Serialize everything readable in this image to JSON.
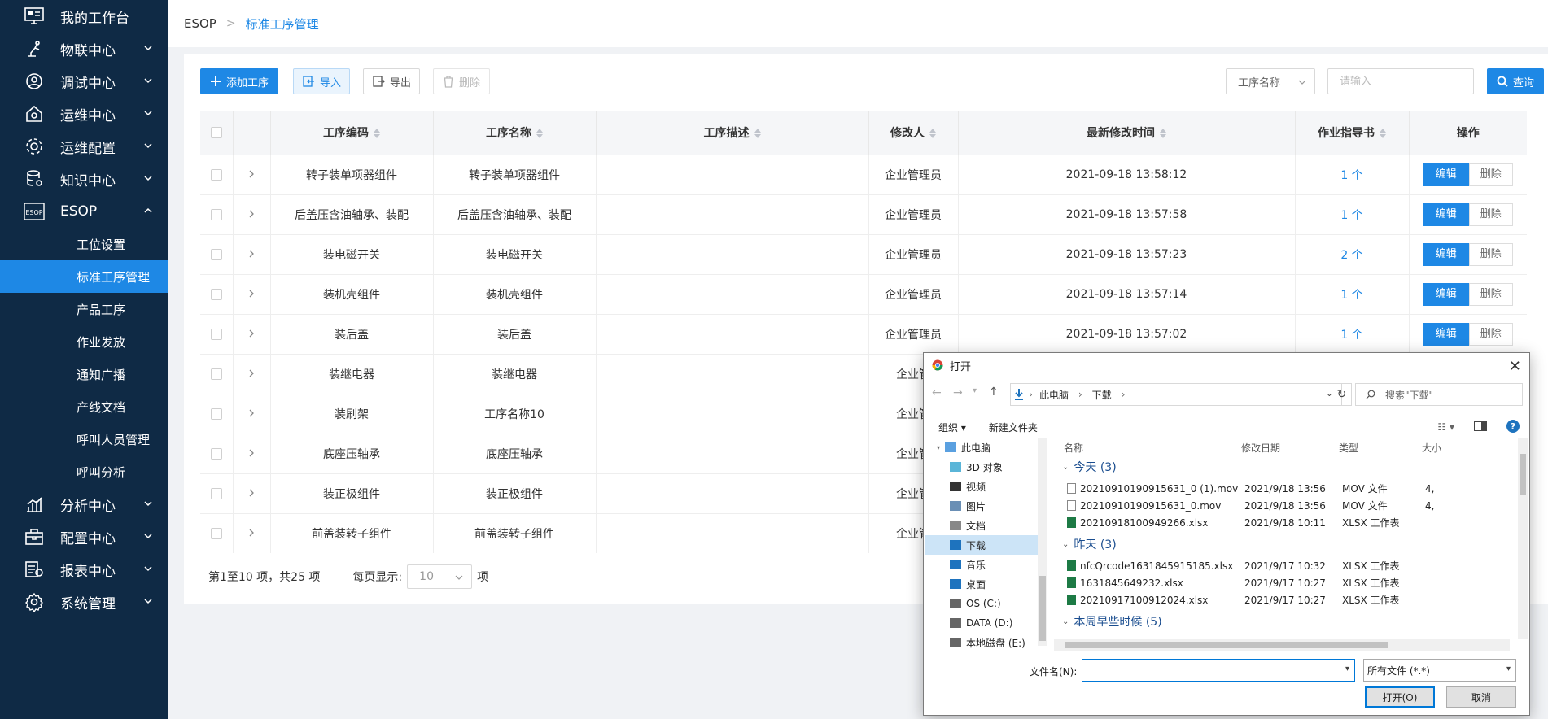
{
  "sidebar": {
    "menu": [
      {
        "label": "我的工作台",
        "icon": "workbench-icon",
        "chevron": false
      },
      {
        "label": "物联中心",
        "icon": "robot-arm-icon",
        "chevron": true
      },
      {
        "label": "调试中心",
        "icon": "debug-icon",
        "chevron": true
      },
      {
        "label": "运维中心",
        "icon": "house-gear-icon",
        "chevron": true
      },
      {
        "label": "运维配置",
        "icon": "gear-icon",
        "chevron": true
      },
      {
        "label": "知识中心",
        "icon": "database-icon",
        "chevron": true
      },
      {
        "label": "ESOP",
        "icon": "esop-icon",
        "chevron": true,
        "expanded": true
      }
    ],
    "esop_badge": "ESOP",
    "submenu": [
      "工位设置",
      "标准工序管理",
      "产品工序",
      "作业发放",
      "通知广播",
      "产线文档",
      "呼叫人员管理",
      "呼叫分析"
    ],
    "active_submenu": "标准工序管理",
    "menu_after": [
      {
        "label": "分析中心",
        "icon": "bar-chart-icon"
      },
      {
        "label": "配置中心",
        "icon": "toolbox-icon"
      },
      {
        "label": "报表中心",
        "icon": "report-icon"
      },
      {
        "label": "系统管理",
        "icon": "settings-icon"
      }
    ]
  },
  "breadcrumb": {
    "root": "ESOP",
    "current": "标准工序管理"
  },
  "toolbar": {
    "add": "添加工序",
    "import": "导入",
    "export": "导出",
    "delete": "删除",
    "filter_field": "工序名称",
    "search_placeholder": "请输入",
    "query": "查询"
  },
  "table": {
    "headers": [
      "工序编码",
      "工序名称",
      "工序描述",
      "修改人",
      "最新修改时间",
      "作业指导书",
      "操作"
    ],
    "rows": [
      {
        "code": "转子装单项器组件",
        "name": "转子装单项器组件",
        "desc": "",
        "modifier": "企业管理员",
        "time": "2021-09-18 13:58:12",
        "docs": "1 个"
      },
      {
        "code": "后盖压含油轴承、装配",
        "name": "后盖压含油轴承、装配",
        "desc": "",
        "modifier": "企业管理员",
        "time": "2021-09-18 13:57:58",
        "docs": "1 个"
      },
      {
        "code": "装电磁开关",
        "name": "装电磁开关",
        "desc": "",
        "modifier": "企业管理员",
        "time": "2021-09-18 13:57:23",
        "docs": "2 个"
      },
      {
        "code": "装机壳组件",
        "name": "装机壳组件",
        "desc": "",
        "modifier": "企业管理员",
        "time": "2021-09-18 13:57:14",
        "docs": "1 个"
      },
      {
        "code": "装后盖",
        "name": "装后盖",
        "desc": "",
        "modifier": "企业管理员",
        "time": "2021-09-18 13:57:02",
        "docs": "1 个"
      },
      {
        "code": "装继电器",
        "name": "装继电器",
        "desc": "",
        "modifier": "企业管",
        "time": "",
        "docs": ""
      },
      {
        "code": "装刷架",
        "name": "工序名称10",
        "desc": "",
        "modifier": "企业管",
        "time": "",
        "docs": ""
      },
      {
        "code": "底座压轴承",
        "name": "底座压轴承",
        "desc": "",
        "modifier": "企业管",
        "time": "",
        "docs": ""
      },
      {
        "code": "装正极组件",
        "name": "装正极组件",
        "desc": "",
        "modifier": "企业管",
        "time": "",
        "docs": ""
      },
      {
        "code": "前盖装转子组件",
        "name": "前盖装转子组件",
        "desc": "",
        "modifier": "企业管",
        "time": "",
        "docs": ""
      }
    ],
    "edit": "编辑",
    "del": "删除"
  },
  "pager": {
    "summary": "第1至10 项，共25 项",
    "per_page_label": "每页显示:",
    "per_page": "10",
    "unit": "项"
  },
  "dialog": {
    "title": "打开",
    "path": [
      "此电脑",
      "下载"
    ],
    "search_placeholder": "搜索\"下载\"",
    "organize": "组织 ▾",
    "new_folder": "新建文件夹",
    "tree": [
      "此电脑",
      "3D 对象",
      "视频",
      "图片",
      "文档",
      "下载",
      "音乐",
      "桌面",
      "OS (C:)",
      "DATA (D:)",
      "本地磁盘 (E:)"
    ],
    "columns": [
      "名称",
      "修改日期",
      "类型",
      "大小"
    ],
    "groups": [
      {
        "label": "今天 (3)",
        "files": [
          {
            "name": "20210910190915631_0 (1).mov",
            "date": "2021/9/18 13:56",
            "type": "MOV 文件",
            "size": "4,"
          },
          {
            "name": "20210910190915631_0.mov",
            "date": "2021/9/18 13:56",
            "type": "MOV 文件",
            "size": "4,"
          },
          {
            "name": "20210918100949266.xlsx",
            "date": "2021/9/18 10:11",
            "type": "XLSX 工作表",
            "size": ""
          }
        ]
      },
      {
        "label": "昨天 (3)",
        "files": [
          {
            "name": "nfcQrcode1631845915185.xlsx",
            "date": "2021/9/17 10:32",
            "type": "XLSX 工作表",
            "size": ""
          },
          {
            "name": "1631845649232.xlsx",
            "date": "2021/9/17 10:27",
            "type": "XLSX 工作表",
            "size": ""
          },
          {
            "name": "20210917100912024.xlsx",
            "date": "2021/9/17 10:27",
            "type": "XLSX 工作表",
            "size": ""
          }
        ]
      },
      {
        "label": "本周早些时候 (5)",
        "files": []
      }
    ],
    "filename_label": "文件名(N):",
    "filetype": "所有文件 (*.*)",
    "open": "打开(O)",
    "cancel": "取消"
  }
}
